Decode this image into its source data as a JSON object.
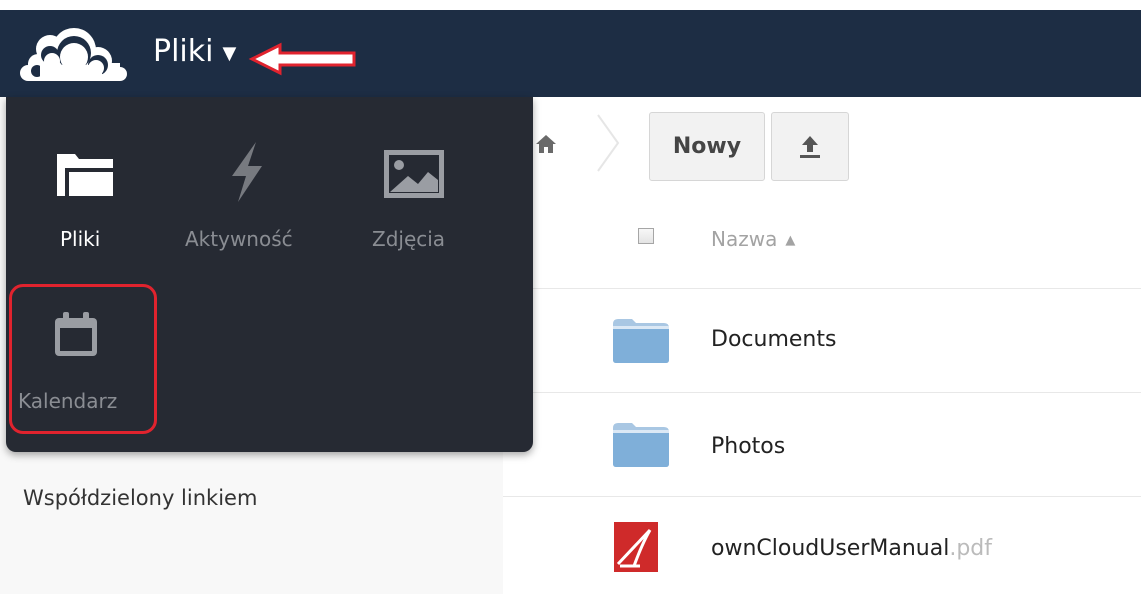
{
  "header": {
    "app_title": "Pliki",
    "caret": "▼"
  },
  "app_menu": {
    "items": [
      {
        "label": "Pliki",
        "icon": "folder-icon"
      },
      {
        "label": "Aktywność",
        "icon": "lightning-icon"
      },
      {
        "label": "Zdjęcia",
        "icon": "image-icon"
      },
      {
        "label": "Kalendarz",
        "icon": "calendar-icon"
      }
    ]
  },
  "sidebar": {
    "shared_link_label": "Współdzielony linkiem"
  },
  "toolbar": {
    "new_label": "Nowy",
    "upload_icon": "upload-icon",
    "home_icon": "home-icon"
  },
  "file_list": {
    "column_name": "Nazwa",
    "sort_indicator": "▲",
    "files": [
      {
        "name": "Documents",
        "ext": "",
        "icon": "folder-icon"
      },
      {
        "name": "Photos",
        "ext": "",
        "icon": "folder-icon"
      },
      {
        "name": "ownCloudUserManual",
        "ext": ".pdf",
        "icon": "pdf-icon"
      }
    ]
  },
  "colors": {
    "header_bg": "#1d2d44",
    "menu_bg": "#262a33",
    "annotation_red": "#e0232e"
  }
}
